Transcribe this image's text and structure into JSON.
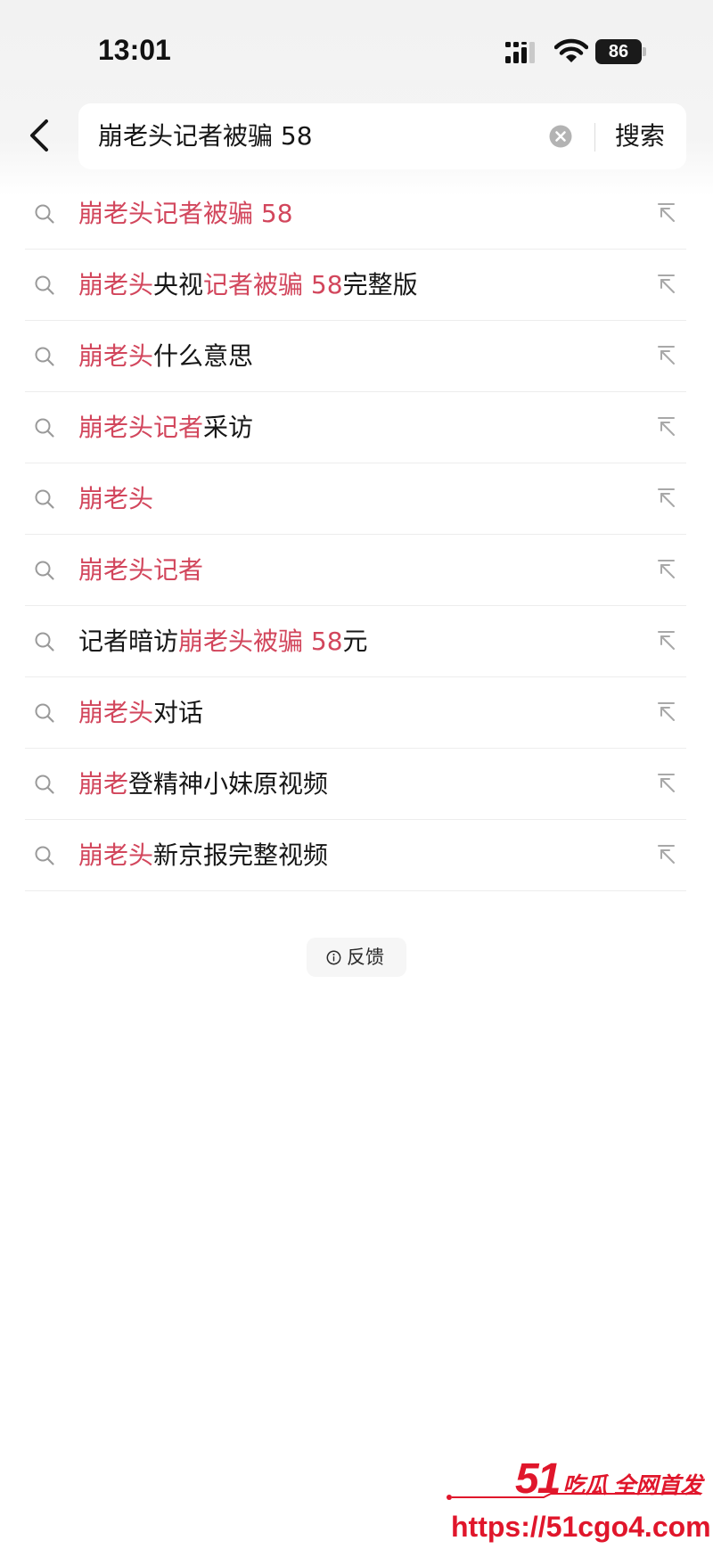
{
  "status_bar": {
    "time": "13:01",
    "battery": "86",
    "icons": [
      "signal-icon",
      "wifi-icon",
      "battery-icon"
    ]
  },
  "search": {
    "query": "崩老头记者被骗 58",
    "button_label": "搜索",
    "icons": [
      "back-icon",
      "clear-icon"
    ]
  },
  "suggestions": [
    {
      "segments": [
        {
          "text": "崩老头记者被骗 58",
          "highlight": true
        }
      ]
    },
    {
      "segments": [
        {
          "text": "崩老头",
          "highlight": true
        },
        {
          "text": "央视",
          "highlight": false
        },
        {
          "text": "记者被骗 58",
          "highlight": true
        },
        {
          "text": "完整版",
          "highlight": false
        }
      ]
    },
    {
      "segments": [
        {
          "text": "崩老头",
          "highlight": true
        },
        {
          "text": "什么意思",
          "highlight": false
        }
      ]
    },
    {
      "segments": [
        {
          "text": "崩老头记者",
          "highlight": true
        },
        {
          "text": "采访",
          "highlight": false
        }
      ]
    },
    {
      "segments": [
        {
          "text": "崩老头",
          "highlight": true
        }
      ]
    },
    {
      "segments": [
        {
          "text": "崩老头记者",
          "highlight": true
        }
      ]
    },
    {
      "segments": [
        {
          "text": "记者暗访",
          "highlight": false
        },
        {
          "text": "崩老头被骗 58",
          "highlight": true
        },
        {
          "text": "元",
          "highlight": false
        }
      ]
    },
    {
      "segments": [
        {
          "text": "崩老头",
          "highlight": true
        },
        {
          "text": "对话",
          "highlight": false
        }
      ]
    },
    {
      "segments": [
        {
          "text": "崩老",
          "highlight": true
        },
        {
          "text": "登精神小妹原视频",
          "highlight": false
        }
      ]
    },
    {
      "segments": [
        {
          "text": "崩老头",
          "highlight": true
        },
        {
          "text": "新京报完整视频",
          "highlight": false
        }
      ]
    }
  ],
  "feedback": {
    "label": "反馈",
    "icon": "info-icon"
  },
  "watermark": {
    "brand_number": "51",
    "slogan": "吃瓜 全网首发",
    "url": "https://51cgo4.com"
  },
  "colors": {
    "highlight": "#d2465c",
    "text": "#161616",
    "header_bg": "#f2f2f2",
    "divider": "#ededed",
    "watermark": "#e0162b"
  }
}
